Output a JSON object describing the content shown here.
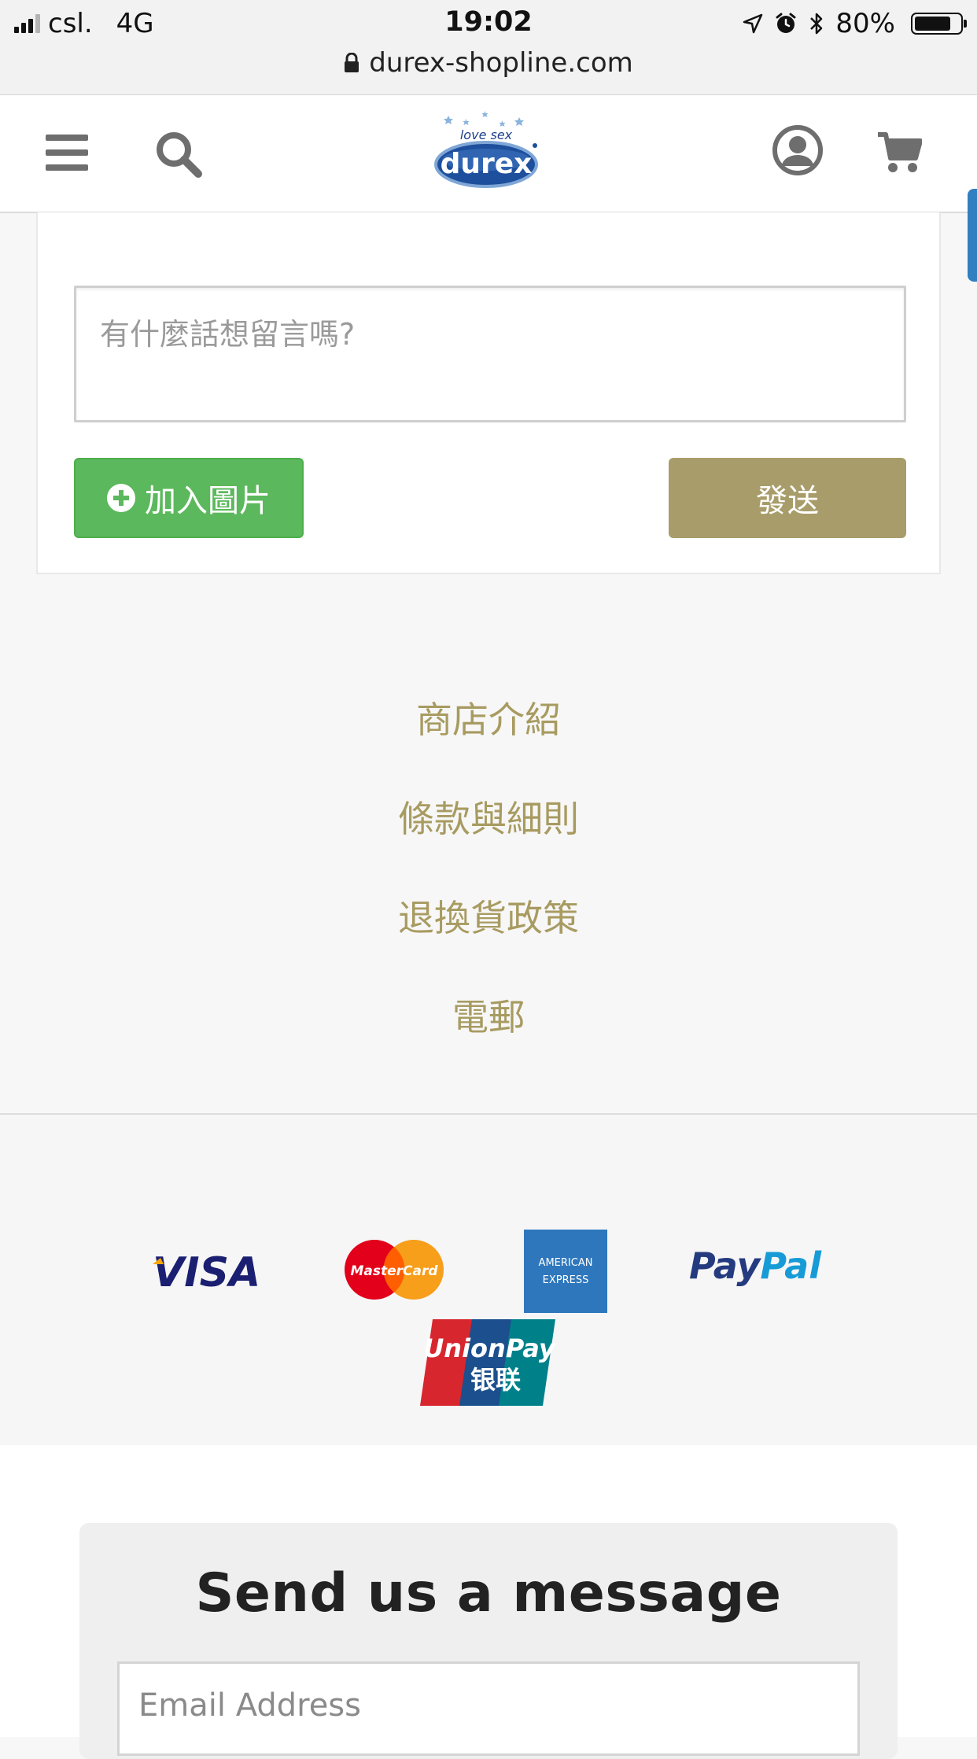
{
  "status_bar": {
    "carrier": "csl.",
    "network": "4G",
    "time": "19:02",
    "battery_text": "80%",
    "battery_level": 0.8,
    "url": "durex-shopline.com"
  },
  "header": {
    "logo_small_text": "love sex",
    "logo_text": "durex"
  },
  "comment": {
    "placeholder": "有什麼話想留言嗎?",
    "add_image_label": "加入圖片",
    "send_label": "發送"
  },
  "footer_links": [
    {
      "label": "商店介紹"
    },
    {
      "label": "條款與細則"
    },
    {
      "label": "退換貨政策"
    },
    {
      "label": "電郵"
    }
  ],
  "payments": {
    "visa": "VISA",
    "mastercard": "MasterCard",
    "amex_line1": "AMERICAN",
    "amex_line2": "EXPRESS",
    "paypal_a": "Pay",
    "paypal_b": "Pal",
    "unionpay": "UnionPay",
    "unionpay_cn": "银联"
  },
  "message": {
    "title": "Send us a message",
    "email_placeholder": "Email Address"
  },
  "colors": {
    "gold": "#a89b61",
    "send_button": "#a89d6a",
    "add_image_button": "#5cb85c",
    "side_tab": "#2f7fc1"
  }
}
